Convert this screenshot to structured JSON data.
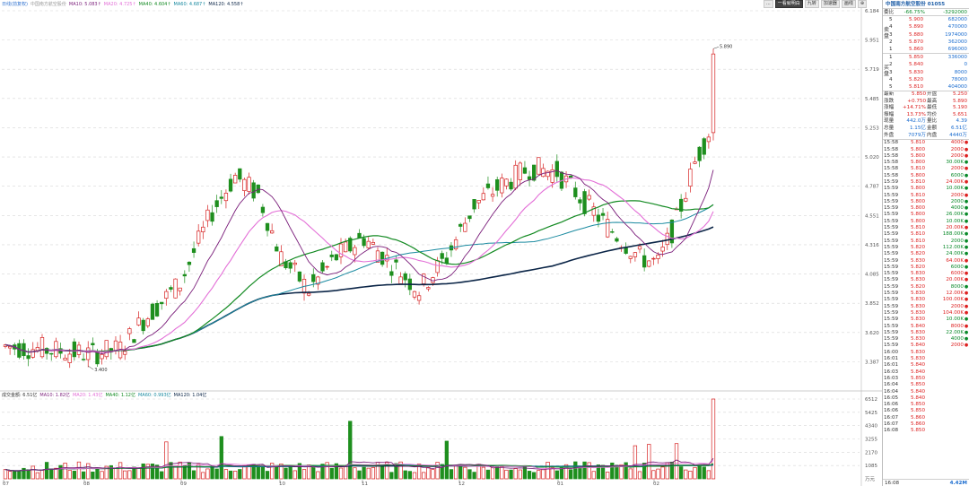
{
  "stock_name": "中国南方航空股份",
  "stock_code": "01055",
  "legend_top": [
    {
      "label": "日线(前复权)",
      "color": "#2b6fcf"
    },
    {
      "label": "中国南方航空股份",
      "color": "#999999"
    },
    {
      "label": "MA10: 5.083↑",
      "color": "#7a1d7a"
    },
    {
      "label": "MA20: 4.725↑",
      "color": "#e36fd7"
    },
    {
      "label": "MA40: 4.604↑",
      "color": "#138a22"
    },
    {
      "label": "MA60: 4.687↑",
      "color": "#1a8aa0"
    },
    {
      "label": "MA120: 4.558↑",
      "color": "#0b2547"
    }
  ],
  "legend_vol": [
    {
      "label": "成交金额: 6.51亿",
      "color": "#333333"
    },
    {
      "label": "MA10: 1.82亿",
      "color": "#7a1d7a"
    },
    {
      "label": "MA20: 1.43亿",
      "color": "#e36fd7"
    },
    {
      "label": "MA40: 1.12亿",
      "color": "#138a22"
    },
    {
      "label": "MA60: 0.993亿",
      "color": "#1a8aa0"
    },
    {
      "label": "MA120: 1.04亿",
      "color": "#0b2547"
    }
  ],
  "toolbar": [
    "...",
    "一看就明白",
    "九转",
    "加速器",
    "画线",
    "⊕"
  ],
  "price_axis": [
    "6.184",
    "5.951",
    "5.719",
    "5.485",
    "5.253",
    "5.020",
    "4.787",
    "4.551",
    "4.316",
    "4.085",
    "3.852",
    "3.620",
    "3.387"
  ],
  "vol_axis": [
    "6512",
    "5425",
    "4340",
    "3255",
    "2170",
    "1085",
    "万元"
  ],
  "month_labels": [
    "07",
    "08",
    "09",
    "10",
    "11",
    "12",
    "01",
    "02"
  ],
  "annot_high": "5.890",
  "annot_low": "3.400",
  "order_book": {
    "weibi_label": "委比",
    "weibi_val": "-66.75%",
    "weicha_label": "委差",
    "weicha_val": "-3292000",
    "sell_mark": "卖盘",
    "buy_mark": "买盘",
    "asks": [
      {
        "lv": "5",
        "px": "5.900",
        "vol": "682000"
      },
      {
        "lv": "4",
        "px": "5.890",
        "vol": "470000"
      },
      {
        "lv": "3",
        "px": "5.880",
        "vol": "1974000"
      },
      {
        "lv": "2",
        "px": "5.870",
        "vol": "362000"
      },
      {
        "lv": "1",
        "px": "5.860",
        "vol": "696000"
      }
    ],
    "bids": [
      {
        "lv": "1",
        "px": "5.850",
        "vol": "336000"
      },
      {
        "lv": "2",
        "px": "5.840",
        "vol": "0"
      },
      {
        "lv": "3",
        "px": "5.830",
        "vol": "8000"
      },
      {
        "lv": "4",
        "px": "5.820",
        "vol": "78000"
      },
      {
        "lv": "5",
        "px": "5.810",
        "vol": "404000"
      }
    ]
  },
  "quote": [
    {
      "l1": "最新",
      "v1": "5.850",
      "l2": "开盘",
      "v2": "5.250"
    },
    {
      "l1": "涨跌",
      "v1": "+0.750",
      "l2": "最高",
      "v2": "5.890"
    },
    {
      "l1": "涨幅",
      "v1": "+14.71%",
      "l2": "最低",
      "v2": "5.190"
    },
    {
      "l1": "振幅",
      "v1": "13.73%",
      "l2": "均价",
      "v2": "5.651"
    },
    {
      "l1": "现量",
      "v1": "442.0万",
      "l2": "量比",
      "v2": "4.39"
    },
    {
      "l1": "总量",
      "v1": "1.15亿",
      "l2": "金额",
      "v2": "6.51亿"
    },
    {
      "l1": "外盘",
      "v1": "7079万",
      "l2": "内盘",
      "v2": "4440万"
    }
  ],
  "ticks": [
    {
      "t": "15:58",
      "px": "5.810",
      "v": "4000",
      "d": "b"
    },
    {
      "t": "15:58",
      "px": "5.800",
      "v": "2000",
      "d": "b"
    },
    {
      "t": "15:58",
      "px": "5.800",
      "v": "2000",
      "d": "b"
    },
    {
      "t": "15:58",
      "px": "5.800",
      "v": "30.00K",
      "d": "s"
    },
    {
      "t": "15:58",
      "px": "5.810",
      "v": "2000",
      "d": "b"
    },
    {
      "t": "15:58",
      "px": "5.800",
      "v": "6000",
      "d": "s"
    },
    {
      "t": "15:59",
      "px": "5.810",
      "v": "24.00K",
      "d": "b"
    },
    {
      "t": "15:59",
      "px": "5.800",
      "v": "10.00K",
      "d": "s"
    },
    {
      "t": "15:59",
      "px": "5.810",
      "v": "2000",
      "d": "b"
    },
    {
      "t": "15:59",
      "px": "5.800",
      "v": "2000",
      "d": "s"
    },
    {
      "t": "15:59",
      "px": "5.800",
      "v": "4000",
      "d": "s"
    },
    {
      "t": "15:59",
      "px": "5.800",
      "v": "26.00K",
      "d": "s"
    },
    {
      "t": "15:59",
      "px": "5.800",
      "v": "10.00K",
      "d": "s"
    },
    {
      "t": "15:59",
      "px": "5.810",
      "v": "20.00K",
      "d": "b"
    },
    {
      "t": "15:59",
      "px": "5.810",
      "v": "188.00K",
      "d": "s"
    },
    {
      "t": "15:59",
      "px": "5.810",
      "v": "2000",
      "d": "s"
    },
    {
      "t": "15:59",
      "px": "5.820",
      "v": "112.00K",
      "d": "s"
    },
    {
      "t": "15:59",
      "px": "5.820",
      "v": "24.00K",
      "d": "s"
    },
    {
      "t": "15:59",
      "px": "5.830",
      "v": "64.00K",
      "d": "b"
    },
    {
      "t": "15:59",
      "px": "5.820",
      "v": "6000",
      "d": "s"
    },
    {
      "t": "15:59",
      "px": "5.830",
      "v": "6000",
      "d": "b"
    },
    {
      "t": "15:59",
      "px": "5.830",
      "v": "20.00K",
      "d": "b"
    },
    {
      "t": "15:59",
      "px": "5.820",
      "v": "8000",
      "d": "s"
    },
    {
      "t": "15:59",
      "px": "5.830",
      "v": "12.00K",
      "d": "b"
    },
    {
      "t": "15:59",
      "px": "5.830",
      "v": "100.00K",
      "d": "b"
    },
    {
      "t": "15:59",
      "px": "5.830",
      "v": "2000",
      "d": "b"
    },
    {
      "t": "15:59",
      "px": "5.830",
      "v": "104.00K",
      "d": "b"
    },
    {
      "t": "15:59",
      "px": "5.830",
      "v": "10.00K",
      "d": "s"
    },
    {
      "t": "15:59",
      "px": "5.840",
      "v": "8000",
      "d": "b"
    },
    {
      "t": "15:59",
      "px": "5.830",
      "v": "22.00K",
      "d": "s"
    },
    {
      "t": "15:59",
      "px": "5.830",
      "v": "4000",
      "d": "s"
    },
    {
      "t": "15:59",
      "px": "5.840",
      "v": "2000",
      "d": "b"
    },
    {
      "t": "16:00",
      "px": "5.830",
      "v": "",
      "d": ""
    },
    {
      "t": "16:01",
      "px": "5.830",
      "v": "",
      "d": ""
    },
    {
      "t": "16:01",
      "px": "5.840",
      "v": "",
      "d": ""
    },
    {
      "t": "16:03",
      "px": "5.840",
      "v": "",
      "d": ""
    },
    {
      "t": "16:03",
      "px": "5.850",
      "v": "",
      "d": ""
    },
    {
      "t": "16:04",
      "px": "5.850",
      "v": "",
      "d": ""
    },
    {
      "t": "16:04",
      "px": "5.840",
      "v": "",
      "d": ""
    },
    {
      "t": "16:05",
      "px": "5.840",
      "v": "",
      "d": ""
    },
    {
      "t": "16:06",
      "px": "5.850",
      "v": "",
      "d": ""
    },
    {
      "t": "16:06",
      "px": "5.850",
      "v": "",
      "d": ""
    },
    {
      "t": "16:07",
      "px": "5.860",
      "v": "",
      "d": ""
    },
    {
      "t": "16:07",
      "px": "5.860",
      "v": "",
      "d": ""
    },
    {
      "t": "16:08",
      "px": "5.850",
      "v": "",
      "d": ""
    }
  ],
  "footer_left": "16:08",
  "footer_right": "4.42M",
  "colors": {
    "up": "#d62020",
    "down": "#1e8f1e",
    "ma10": "#7a1d7a",
    "ma20": "#e36fd7",
    "ma40": "#138a22",
    "ma60": "#1a8aa0",
    "ma120": "#0b2547"
  }
}
